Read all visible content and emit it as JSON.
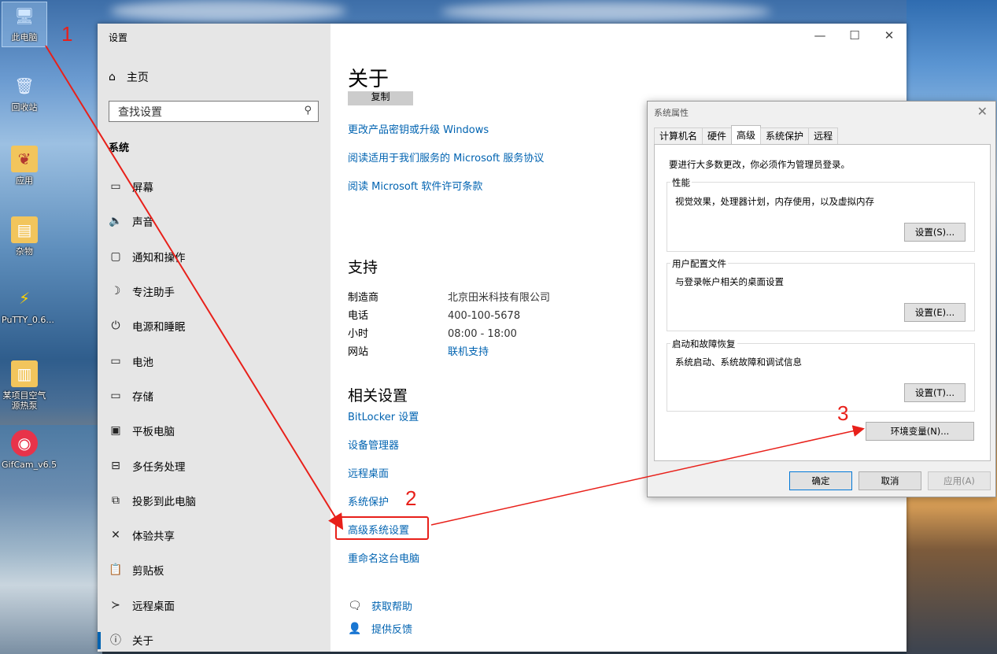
{
  "desktop": {
    "icons": [
      {
        "label": "此电脑",
        "icon": "computer-icon"
      },
      {
        "label": "回收站",
        "icon": "recycle-bin-icon"
      },
      {
        "label": "应用",
        "icon": "folder-icon"
      },
      {
        "label": "杂物",
        "icon": "folder-icon"
      },
      {
        "label": "PuTTY_0.6...",
        "icon": "putty-icon"
      },
      {
        "label": "某项目空气源热泵",
        "icon": "folder-icon"
      },
      {
        "label": "GifCam_v6.5",
        "icon": "camera-icon"
      }
    ]
  },
  "settings": {
    "window_title": "设置",
    "controls": {
      "minimize": "—",
      "maximize": "☐",
      "close": "✕"
    },
    "home_label": "主页",
    "search_placeholder": "查找设置",
    "section": "系统",
    "nav": [
      {
        "label": "屏幕",
        "icon": "monitor-icon",
        "glyph": "▭"
      },
      {
        "label": "声音",
        "icon": "speaker-icon",
        "glyph": "🔈"
      },
      {
        "label": "通知和操作",
        "icon": "notification-icon",
        "glyph": "▢"
      },
      {
        "label": "专注助手",
        "icon": "moon-icon",
        "glyph": "☽"
      },
      {
        "label": "电源和睡眠",
        "icon": "power-icon",
        "glyph": "⏻"
      },
      {
        "label": "电池",
        "icon": "battery-icon",
        "glyph": "▭"
      },
      {
        "label": "存储",
        "icon": "storage-icon",
        "glyph": "▭"
      },
      {
        "label": "平板电脑",
        "icon": "tablet-icon",
        "glyph": "▣"
      },
      {
        "label": "多任务处理",
        "icon": "multitask-icon",
        "glyph": "⊟"
      },
      {
        "label": "投影到此电脑",
        "icon": "project-icon",
        "glyph": "⧉"
      },
      {
        "label": "体验共享",
        "icon": "share-icon",
        "glyph": "✕"
      },
      {
        "label": "剪贴板",
        "icon": "clipboard-icon",
        "glyph": "📋"
      },
      {
        "label": "远程桌面",
        "icon": "remote-icon",
        "glyph": "≻"
      },
      {
        "label": "关于",
        "icon": "info-icon",
        "glyph": "ⓘ"
      }
    ],
    "main": {
      "title": "关于",
      "copy_button": "复制",
      "links_top": [
        "更改产品密钥或升级 Windows",
        "阅读适用于我们服务的 Microsoft 服务协议",
        "阅读 Microsoft 软件许可条款"
      ],
      "support_title": "支持",
      "support": [
        {
          "key": "制造商",
          "value": "北京田米科技有限公司"
        },
        {
          "key": "电话",
          "value": "400-100-5678"
        },
        {
          "key": "小时",
          "value": "08:00 - 18:00"
        },
        {
          "key": "网站",
          "value": "联机支持"
        }
      ],
      "related_title": "相关设置",
      "related_links": [
        "BitLocker 设置",
        "设备管理器",
        "远程桌面",
        "系统保护",
        "高级系统设置",
        "重命名这台电脑"
      ],
      "help": "获取帮助",
      "feedback": "提供反馈"
    }
  },
  "sysprop": {
    "title": "系统属性",
    "close": "✕",
    "tabs": [
      "计算机名",
      "硬件",
      "高级",
      "系统保护",
      "远程"
    ],
    "active_tab": "高级",
    "note": "要进行大多数更改，你必须作为管理员登录。",
    "groups": [
      {
        "title": "性能",
        "desc": "视觉效果，处理器计划，内存使用，以及虚拟内存",
        "button": "设置(S)..."
      },
      {
        "title": "用户配置文件",
        "desc": "与登录帐户相关的桌面设置",
        "button": "设置(E)..."
      },
      {
        "title": "启动和故障恢复",
        "desc": "系统启动、系统故障和调试信息",
        "button": "设置(T)..."
      }
    ],
    "env_button": "环境变量(N)...",
    "ok": "确定",
    "cancel": "取消",
    "apply": "应用(A)"
  },
  "annotations": [
    "1",
    "2",
    "3"
  ],
  "colors": {
    "link": "#0063b1",
    "annotation": "#e8201a",
    "accent": "#0078d7"
  }
}
